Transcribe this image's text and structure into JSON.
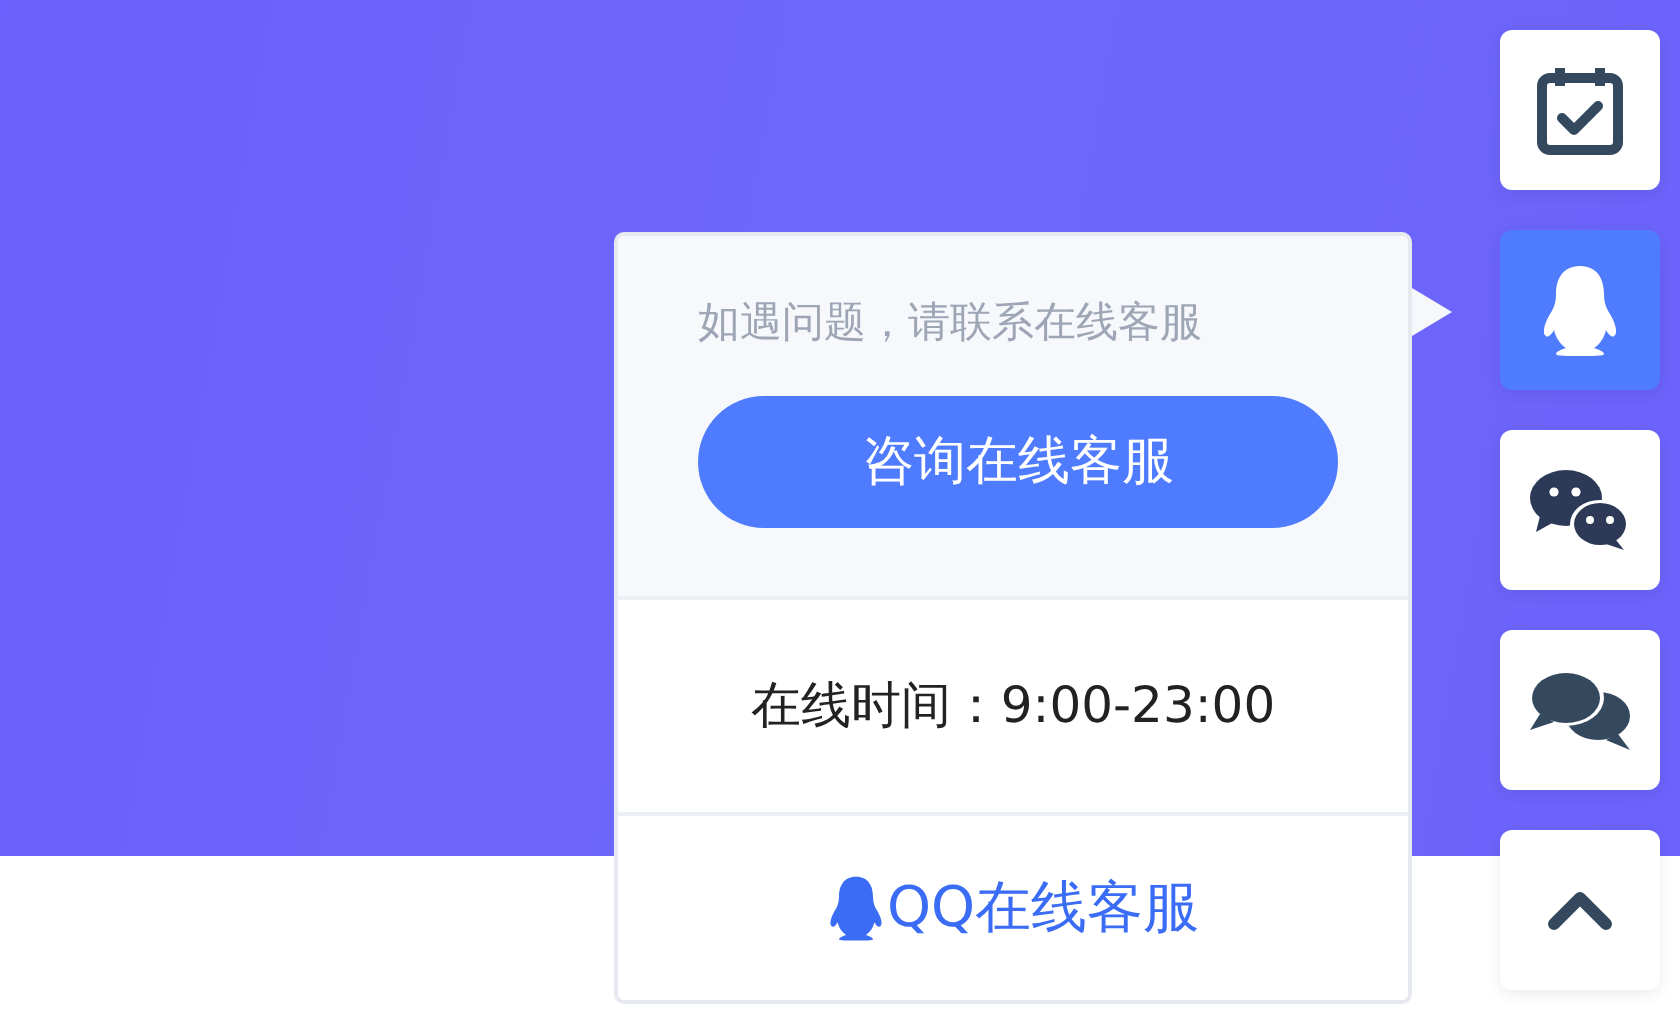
{
  "sidebar": {
    "items": [
      {
        "kind": "calendar",
        "selected": false
      },
      {
        "kind": "qq",
        "selected": true
      },
      {
        "kind": "wechat",
        "selected": false
      },
      {
        "kind": "chat",
        "selected": false
      },
      {
        "kind": "top",
        "selected": false
      }
    ]
  },
  "popup": {
    "hint": "如遇问题，请联系在线客服",
    "button": "咨询在线客服",
    "hours": "在线时间：9:00-23:00",
    "qq_link": "QQ在线客服"
  }
}
